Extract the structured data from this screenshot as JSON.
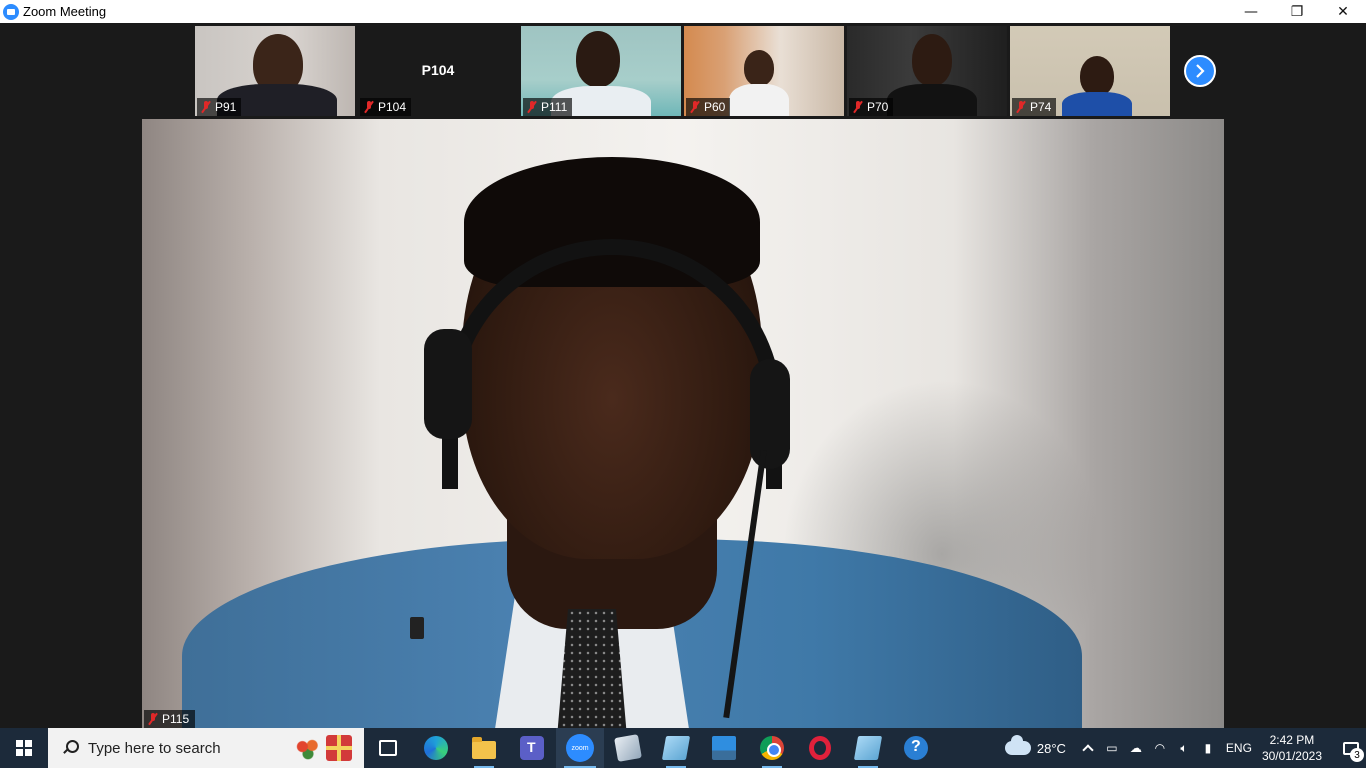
{
  "window": {
    "title": "Zoom Meeting",
    "minimize": "—",
    "restore": "❐",
    "close": "✕"
  },
  "gallery": {
    "participants": [
      {
        "name": "P91",
        "muted": true,
        "video": true
      },
      {
        "name": "P104",
        "muted": true,
        "video": false,
        "center_name": "P104"
      },
      {
        "name": "P111",
        "muted": true,
        "video": true
      },
      {
        "name": "P60",
        "muted": true,
        "video": true
      },
      {
        "name": "P70",
        "muted": true,
        "video": true
      },
      {
        "name": "P74",
        "muted": true,
        "video": true
      }
    ],
    "next_icon": "chevron-right-icon"
  },
  "main_video": {
    "name": "P115",
    "muted": true
  },
  "taskbar": {
    "search_placeholder": "Type here to search",
    "apps": [
      "task-view",
      "edge",
      "file-explorer",
      "teams",
      "zoom",
      "snipping-tool",
      "notepad",
      "photos",
      "chrome",
      "opera",
      "notepad-2",
      "get-help"
    ],
    "zoom_label": "zoom",
    "weather": "28°C",
    "language": "ENG",
    "time": "2:42 PM",
    "date": "30/01/2023",
    "notification_count": "3"
  },
  "colors": {
    "accent": "#2d8cff",
    "muted": "#e02828",
    "taskbar": "#1c2a3a"
  }
}
